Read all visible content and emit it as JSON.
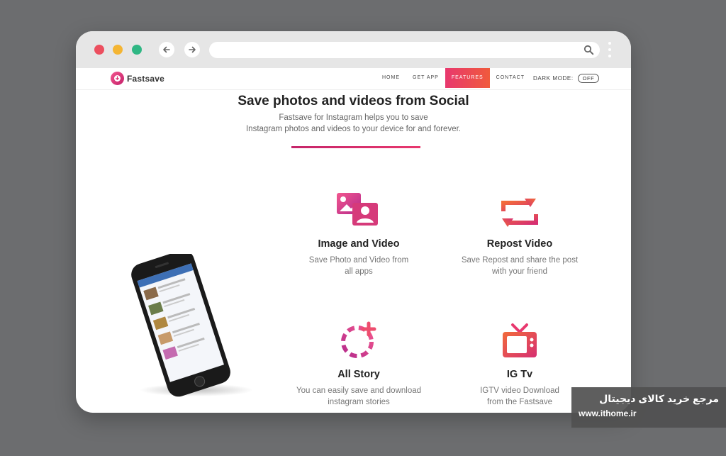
{
  "nav": {
    "logo_text": "Fastsave",
    "items": [
      "HOME",
      "GET APP",
      "FEATURES",
      "CONTACT"
    ],
    "active": "FEATURES",
    "dark_mode_label": "DARK MODE:",
    "dark_mode_value": "OFF"
  },
  "hero": {
    "title": "Save photos and videos from Social",
    "line1": "Fastsave for Instagram helps you to save",
    "line2": "Instagram photos and videos to your device for and forever."
  },
  "features": [
    {
      "title": "Image and Video",
      "line1": "Save Photo and Video from",
      "line2": "all apps",
      "icon": "image-video-icon"
    },
    {
      "title": "Repost Video",
      "line1": "Save Repost and share the post",
      "line2": "with your friend",
      "icon": "repost-icon"
    },
    {
      "title": "All Story",
      "line1": "You can easily save and download",
      "line2": "instagram stories",
      "icon": "story-add-icon"
    },
    {
      "title": "IG Tv",
      "line1": "IGTV video Download",
      "line2": "from the Fastsave",
      "icon": "tv-icon"
    }
  ],
  "watermark": {
    "persian": "مرجع خرید کالای دیجیتال",
    "url": "www.ithome.ir"
  },
  "colors": {
    "accent_start": "#e8386e",
    "accent_end": "#f05a3c",
    "background": "#6c6d6f"
  }
}
